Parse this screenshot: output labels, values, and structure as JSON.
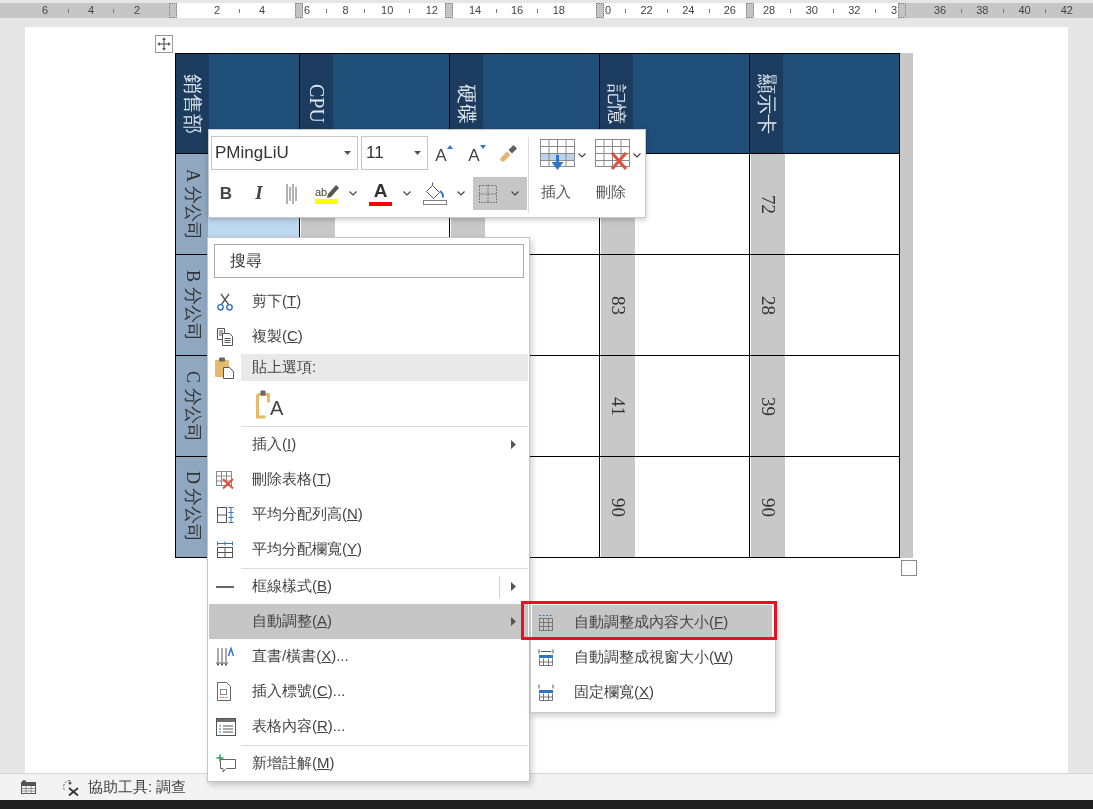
{
  "ruler": {
    "segments": [
      [
        "6",
        "4",
        "2"
      ],
      [
        "2",
        "4"
      ],
      [
        "6",
        "8",
        "10",
        "12"
      ],
      [
        "14",
        "16",
        "18"
      ],
      [
        "0",
        "22",
        "24",
        "26"
      ],
      [
        "28",
        "30",
        "32",
        "3"
      ],
      [
        "36",
        "38",
        "40",
        "42"
      ]
    ]
  },
  "table": {
    "columns": [
      "銷售部",
      "CPU",
      "硬碟",
      "記憶",
      "顯示卡"
    ],
    "rows": [
      {
        "label": "A 分公司",
        "selected": true,
        "column_5": "72"
      },
      {
        "label": "B 分公司",
        "column_4": "83",
        "column_5": "28"
      },
      {
        "label": "C 分公司",
        "column_4": "41",
        "column_5": "39"
      },
      {
        "label": "D 分公司",
        "column_4": "90",
        "column_5": "90"
      }
    ]
  },
  "mini_toolbar": {
    "font_name": "PMingLiU",
    "font_size": "11",
    "size_buttons": [
      {
        "kind": "grow",
        "glyph": "A"
      },
      {
        "kind": "shrink",
        "glyph": "A"
      },
      {
        "kind": "painter"
      }
    ],
    "format_buttons": [
      {
        "kind": "bold",
        "glyph": "B",
        "selected": false
      },
      {
        "kind": "italic",
        "glyph": "I",
        "selected": false
      },
      {
        "kind": "lines",
        "selected": false
      },
      {
        "kind": "highlight",
        "glyph": "ab",
        "color": "#ffff00",
        "selected": false
      },
      {
        "kind": "font-color",
        "glyph": "A",
        "color": "#ff0000",
        "selected": false
      },
      {
        "kind": "shading",
        "selected": false
      },
      {
        "kind": "borders",
        "selected": true
      }
    ],
    "table_buttons": [
      {
        "kind": "insert",
        "label": "插入"
      },
      {
        "kind": "delete",
        "label": "刪除"
      }
    ]
  },
  "context_menu": {
    "search_placeholder": "搜尋",
    "groups": [
      [
        {
          "kind": "command",
          "label": "剪下(",
          "hotkey": "T",
          "suffix": ")",
          "submenu": false,
          "selected": false
        },
        {
          "kind": "command",
          "label": "複製(",
          "hotkey": "C",
          "suffix": ")",
          "submenu": false,
          "selected": false
        },
        {
          "kind": "heading",
          "label": "貼上選項:"
        },
        {
          "kind": "paste",
          "glyph": "A",
          "selected": false
        }
      ],
      [
        {
          "kind": "command",
          "label": "插入(",
          "hotkey": "I",
          "suffix": ")",
          "submenu": true,
          "selected": false
        },
        {
          "kind": "command",
          "label": "刪除表格(",
          "hotkey": "T",
          "suffix": ")",
          "submenu": false,
          "selected": false
        },
        {
          "kind": "command",
          "label": "平均分配列高(",
          "hotkey": "N",
          "suffix": ")",
          "submenu": false,
          "selected": false
        },
        {
          "kind": "command",
          "label": "平均分配欄寬(",
          "hotkey": "Y",
          "suffix": ")",
          "submenu": false,
          "selected": false
        }
      ],
      [
        {
          "kind": "split",
          "label": "框線樣式(",
          "hotkey": "B",
          "suffix": ")",
          "submenu": true,
          "selected": false
        },
        {
          "kind": "command",
          "label": "自動調整(",
          "hotkey": "A",
          "suffix": ")",
          "submenu": true,
          "selected": true
        },
        {
          "kind": "command",
          "label": "直書/橫書(",
          "hotkey": "X",
          "suffix": ")...",
          "submenu": false,
          "selected": false
        },
        {
          "kind": "command",
          "label": "插入標號(",
          "hotkey": "C",
          "suffix": ")...",
          "submenu": false,
          "selected": false
        },
        {
          "kind": "command",
          "label": "表格內容(",
          "hotkey": "R",
          "suffix": ")...",
          "submenu": false,
          "selected": false
        }
      ],
      [
        {
          "kind": "command",
          "label": "新增註解(",
          "hotkey": "M",
          "suffix": ")",
          "submenu": false,
          "selected": false
        }
      ]
    ]
  },
  "submenu": {
    "items": [
      {
        "label": "自動調整成內容大小(",
        "hotkey": "F",
        "suffix": ")",
        "selected": true,
        "outlined": true
      },
      {
        "label": "自動調整成視窗大小(",
        "hotkey": "W",
        "suffix": ")",
        "selected": false,
        "outlined": false
      },
      {
        "label": "固定欄寬(",
        "hotkey": "X",
        "suffix": ")",
        "selected": false,
        "outlined": false
      }
    ]
  },
  "status_bar": {
    "accessibility": "協助工具: 調查"
  }
}
